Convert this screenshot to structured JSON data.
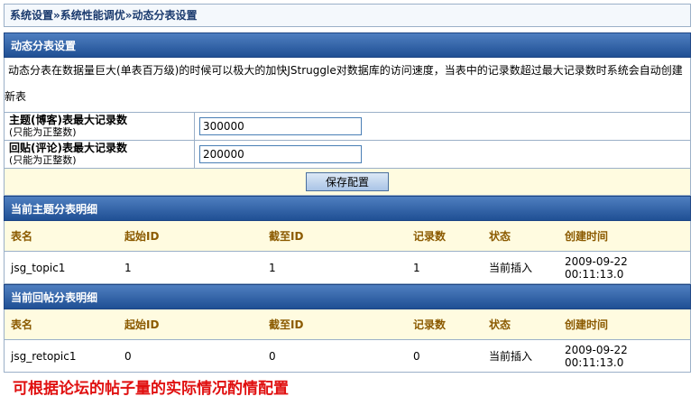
{
  "breadcrumb": "系统设置»系统性能调优»动态分表设置",
  "section_dynamic": "动态分表设置",
  "description_line1": "动态分表在数据量巨大(单表百万级)的时候可以极大的加快JStruggle对数据库的访问速度，当表中的记录数超过最大记录数时系统会自动创建",
  "description_line2": "新表",
  "fields": [
    {
      "label": "主题(博客)表最大记录数",
      "hint": "(只能为正整数)",
      "value": "300000"
    },
    {
      "label": "回贴(评论)表最大记录数",
      "hint": "(只能为正整数)",
      "value": "200000"
    }
  ],
  "save_label": "保存配置",
  "topic_section": {
    "title": "当前主题分表明细",
    "headers": [
      "表名",
      "起始ID",
      "截至ID",
      "记录数",
      "状态",
      "创建时间"
    ],
    "row": [
      "jsg_topic1",
      "1",
      "1",
      "1",
      "当前插入",
      "2009-09-22 00:11:13.0"
    ]
  },
  "retopic_section": {
    "title": "当前回帖分表明细",
    "headers": [
      "表名",
      "起始ID",
      "截至ID",
      "记录数",
      "状态",
      "创建时间"
    ],
    "row": [
      "jsg_retopic1",
      "0",
      "0",
      "0",
      "当前插入",
      "2009-09-22 00:11:13.0"
    ]
  },
  "note": "可根据论坛的帖子量的实际情况酌情配置"
}
